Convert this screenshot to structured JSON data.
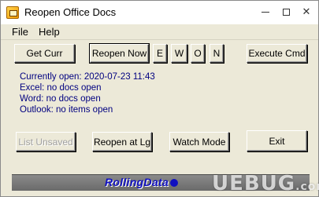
{
  "window": {
    "title": "Reopen Office Docs",
    "controls": {
      "minimize_icon": "minimize-icon",
      "maximize_icon": "maximize-icon",
      "close_icon": "close-icon",
      "close_glyph": "✕"
    }
  },
  "menu": {
    "items": [
      {
        "label": "File"
      },
      {
        "label": "Help"
      }
    ]
  },
  "toolbar": {
    "get_curr": "Get Curr",
    "reopen_now": "Reopen Now",
    "e": "E",
    "w": "W",
    "o": "O",
    "n": "N",
    "execute_cmd": "Execute Cmd"
  },
  "status": {
    "currently_open_label": "Currently open:",
    "currently_open_time": "2020-07-23 11:43",
    "excel": "Excel: no docs open",
    "word": "Word: no docs open",
    "outlook": "Outlook: no items open"
  },
  "actions": {
    "list_unsaved": "List  Unsaved",
    "reopen_at_lg": "Reopen at Lg",
    "watch_mode": "Watch Mode",
    "exit": "Exit"
  },
  "footer": {
    "logo": "RollingData"
  },
  "watermark": {
    "text": "UEBUG",
    "suffix": ".com"
  },
  "colors": {
    "status_text": "#000080",
    "logo_text": "#1010c0",
    "window_bg": "#ece9d8"
  }
}
